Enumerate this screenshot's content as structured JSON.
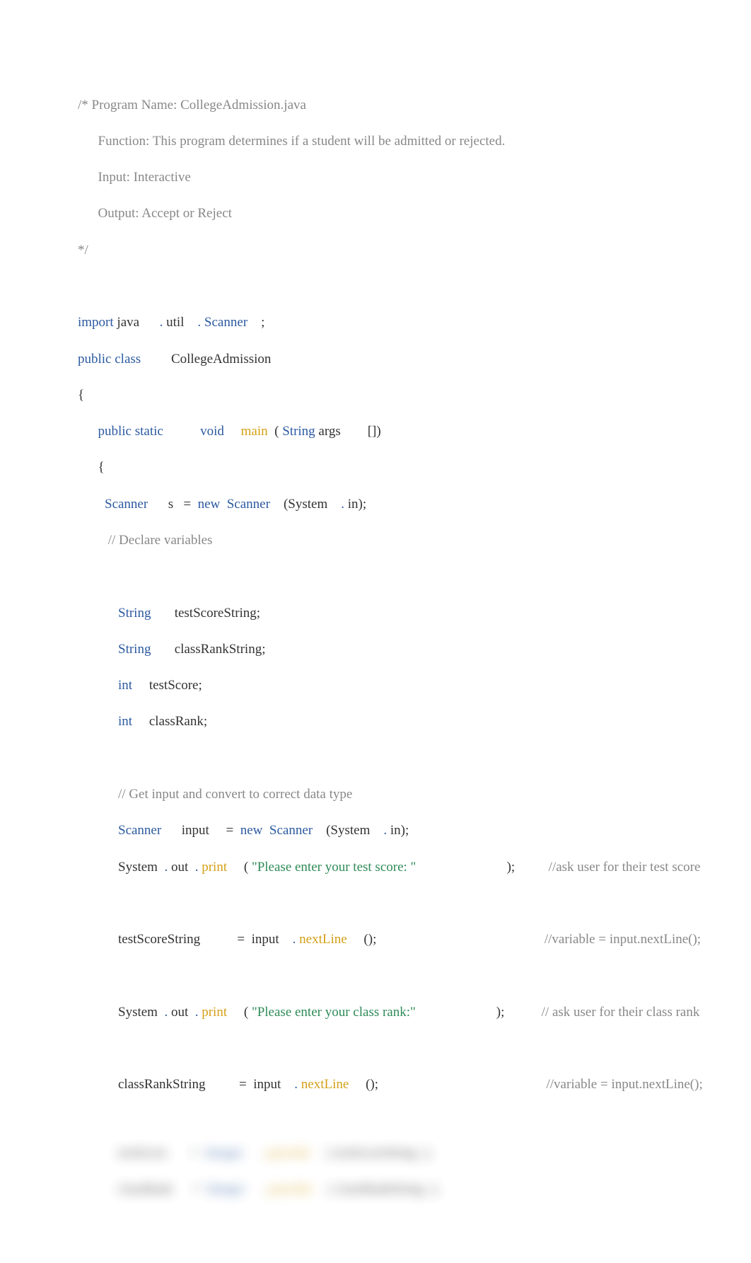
{
  "code": {
    "comment_block": {
      "l1": "/* Program Name: CollegeAdmission.java",
      "l2": "      Function: This program determines if a student will be admitted or rejected.",
      "l3": "      Input: Interactive",
      "l4": "      Output: Accept or Reject",
      "l5": "*/"
    },
    "import_line": {
      "import": "import",
      "java": "java",
      "dot1": ".",
      "util": "util",
      "dot2": ".",
      "scanner": "Scanner",
      "semi": ";"
    },
    "class_decl": {
      "public": "public",
      "class": "class",
      "name": "CollegeAdmission"
    },
    "brace_open": "{",
    "main_decl": {
      "indent": "      ",
      "public": "public",
      "static": "static",
      "void": "void",
      "main": "main",
      "lparen": "(",
      "string": "String",
      "args": "args",
      "brackets": "[])"
    },
    "main_brace": "      {",
    "scanner_s": {
      "indent": "        ",
      "scanner": "Scanner",
      "s": "s",
      "eq": "=",
      "new": "new",
      "scanner2": "Scanner",
      "lparen": "(System",
      "dot": ".",
      "in": "in);"
    },
    "declare_comment": "         // Declare variables",
    "var1": {
      "indent": "            ",
      "type": "String",
      "name": "testScoreString;"
    },
    "var2": {
      "indent": "            ",
      "type": "String",
      "name": "classRankString;"
    },
    "var3": {
      "indent": "            ",
      "type": "int",
      "name": "testScore;"
    },
    "var4": {
      "indent": "            ",
      "type": "int",
      "name": "classRank;"
    },
    "input_comment": "            // Get input and convert to correct data type",
    "scanner_input": {
      "indent": "            ",
      "scanner": "Scanner",
      "input": "input",
      "eq": "=",
      "new": "new",
      "scanner2": "Scanner",
      "lparen": "(System",
      "dot": ".",
      "in": "in);"
    },
    "print1": {
      "indent": "            ",
      "system": "System",
      "dot1": ".",
      "out": "out",
      "dot2": ".",
      "print": "print",
      "lparen": "(",
      "str": "\"Please enter your test score: \"",
      "rparen": ");",
      "comment": "//ask user for their test score"
    },
    "assign1": {
      "indent": "            ",
      "var": "testScoreString",
      "eq": "=",
      "input": "input",
      "dot": ".",
      "method": "nextLine",
      "paren": "();",
      "comment": "//variable = input.nextLine();"
    },
    "print2": {
      "indent": "            ",
      "system": "System",
      "dot1": ".",
      "out": "out",
      "dot2": ".",
      "print": "print",
      "lparen": "(",
      "str": "\"Please enter your class rank:\"",
      "rparen": ");",
      "comment": "// ask user for their class rank"
    },
    "assign2": {
      "indent": "            ",
      "var": "classRankString",
      "eq": "=",
      "input": "input",
      "dot": ".",
      "method": "nextLine",
      "paren": "();",
      "comment": "//variable = input.nextLine();"
    },
    "blurred": {
      "l1_a": "testScore",
      "l1_b": "Integer",
      "l1_c": "parseInt",
      "l1_d": "testScoreString",
      "l2_a": "classRank",
      "l2_b": "Integer",
      "l2_c": "parseInt",
      "l2_d": "classRankString"
    }
  }
}
